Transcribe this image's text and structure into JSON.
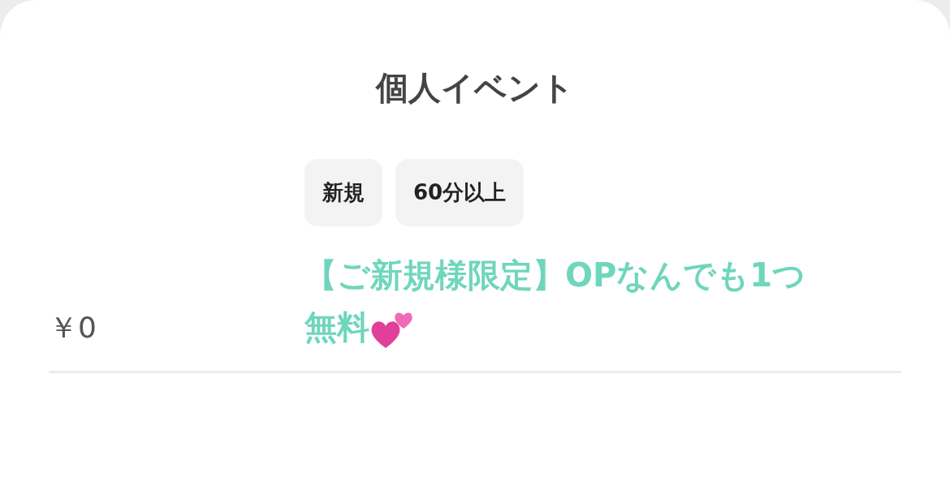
{
  "title": "個人イベント",
  "tags": [
    "新規",
    "60分以上"
  ],
  "price": "￥0",
  "offer": {
    "line_1": "【ご新規様限定】OPなんでも1つ",
    "line_2": "無料"
  }
}
